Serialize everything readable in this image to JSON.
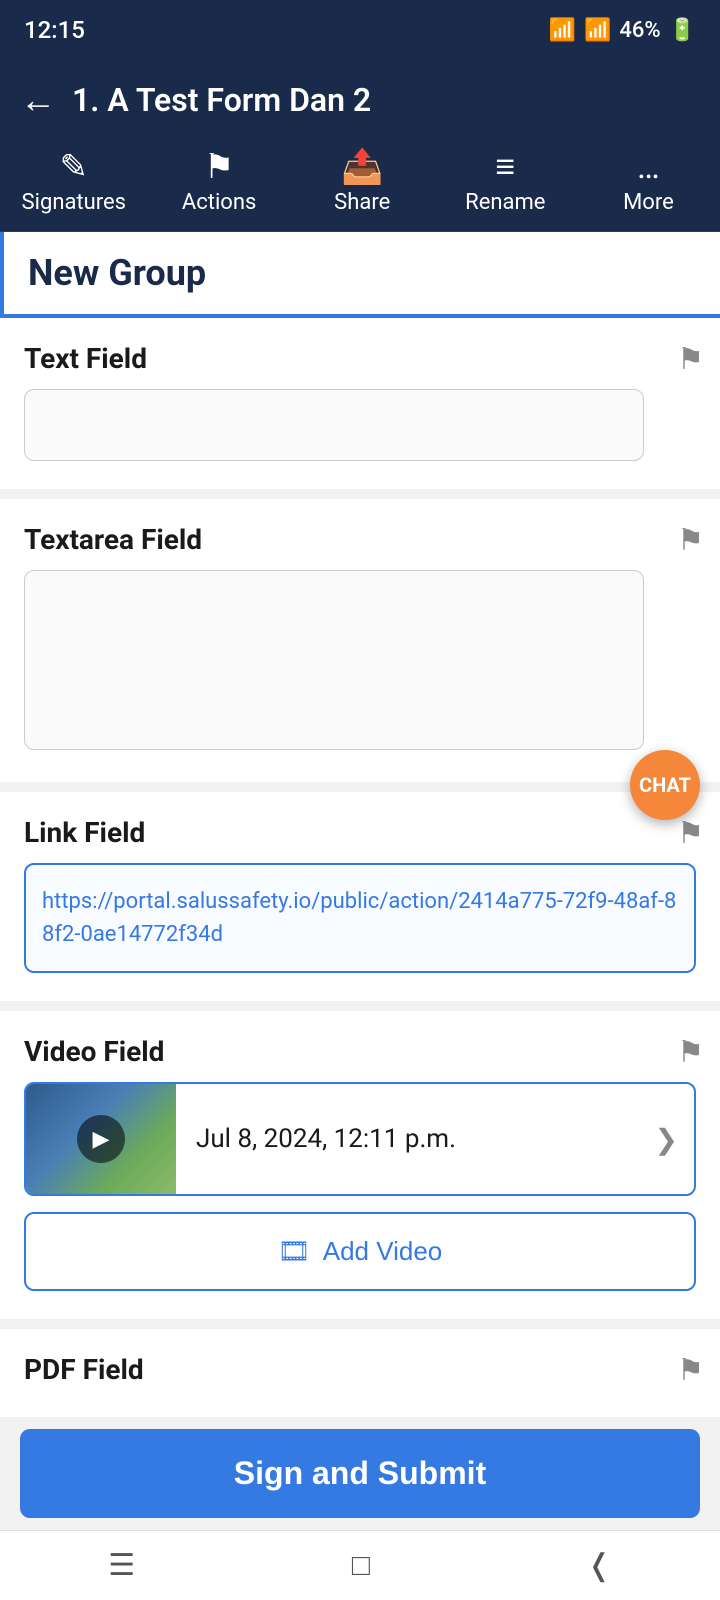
{
  "statusBar": {
    "time": "12:15",
    "battery": "46%"
  },
  "header": {
    "backLabel": "←",
    "title": "1. A Test Form Dan 2"
  },
  "toolbar": {
    "signatures": "Signatures",
    "actions": "Actions",
    "share": "Share",
    "rename": "Rename",
    "more": "More"
  },
  "group": {
    "title": "New Group"
  },
  "fields": {
    "textField": {
      "label": "Text Field",
      "placeholder": ""
    },
    "textareaField": {
      "label": "Textarea Field",
      "placeholder": ""
    },
    "linkField": {
      "label": "Link Field",
      "value": "https://portal.salussafety.io/public/action/2414a775-72f9-48af-88f2-0ae14772f34d"
    },
    "videoField": {
      "label": "Video Field",
      "videoDate": "Jul 8, 2024, 12:11 p.m.",
      "addVideoLabel": "Add Video"
    },
    "pdfField": {
      "label": "PDF Field"
    }
  },
  "signSubmit": {
    "label": "Sign and Submit"
  },
  "fab": {
    "label": "CHAT"
  }
}
